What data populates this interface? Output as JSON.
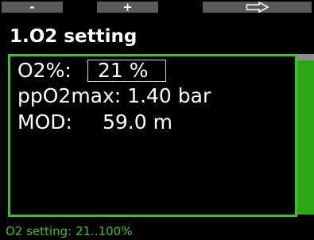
{
  "softkeys": {
    "left_label": "-",
    "center_label": "+",
    "right_icon": "arrow-right-outline-icon"
  },
  "page": {
    "title": "1.O2 setting"
  },
  "settings": {
    "o2_label": "O2%:",
    "o2_value": "21 %",
    "ppo2max_label": "ppO2max:",
    "ppo2max_value": "1.40 bar",
    "mod_label": "MOD:",
    "mod_value": "59.0 m"
  },
  "hint": {
    "text": "O2 setting: 21..100%"
  },
  "colors": {
    "background": "#000000",
    "accent_green": "#3fc12f",
    "scrollbar_green": "#2da814",
    "softkey_gray": "#5a5a5a",
    "text": "#ffffff"
  }
}
